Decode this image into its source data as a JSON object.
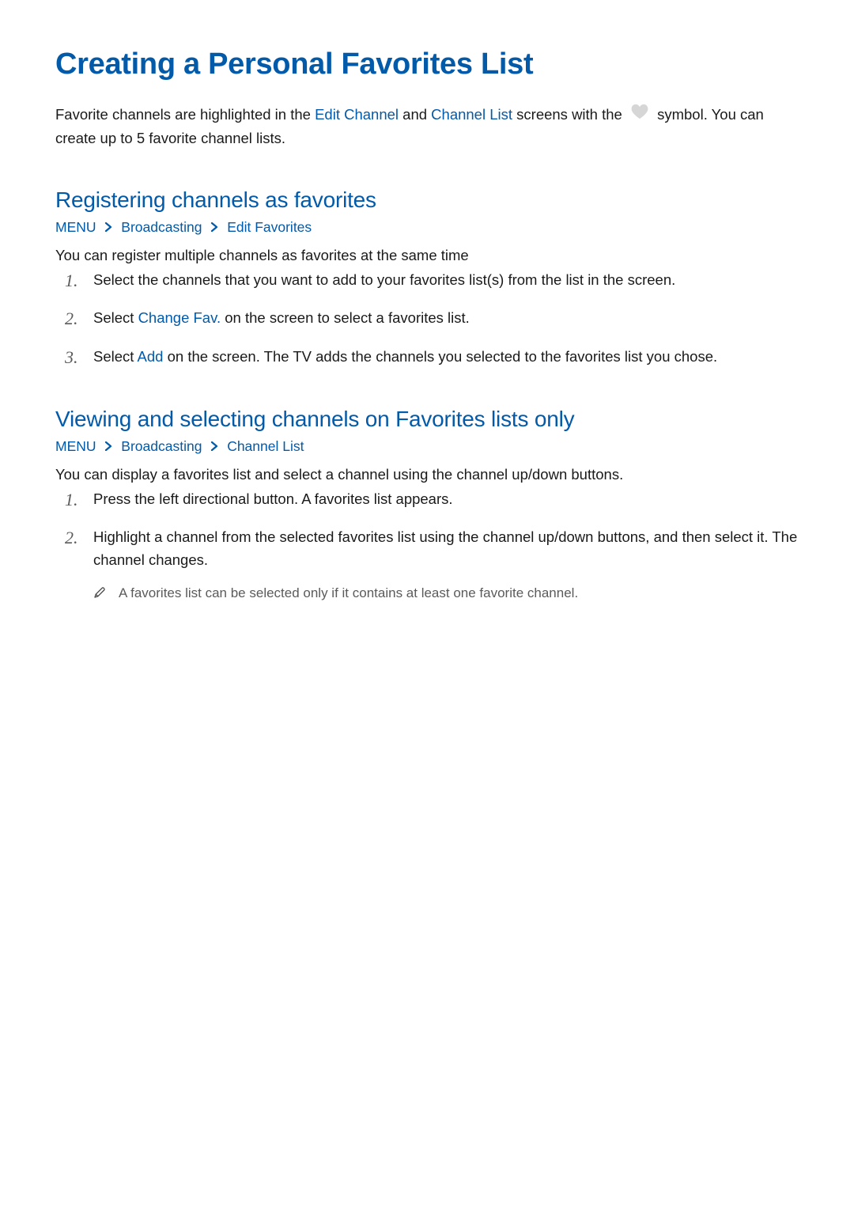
{
  "page_title": "Creating a Personal Favorites List",
  "intro": {
    "part1": "Favorite channels are highlighted in the ",
    "edit_channel": "Edit Channel",
    "and": " and ",
    "channel_list": "Channel List",
    "part2": " screens with the ",
    "part3": " symbol. You can create up to 5 favorite channel lists."
  },
  "section1": {
    "title": "Registering channels as favorites",
    "breadcrumb": {
      "menu": "MENU",
      "b1": "Broadcasting",
      "b2": "Edit Favorites"
    },
    "lead": "You can register multiple channels as favorites at the same time",
    "steps": [
      {
        "text": "Select the channels that you want to add to your favorites list(s) from the list in the screen."
      },
      {
        "prefix": "Select ",
        "accent": "Change Fav.",
        "suffix": " on the screen to select a favorites list."
      },
      {
        "prefix": "Select ",
        "accent": "Add",
        "suffix": " on the screen. The TV adds the channels you selected to the favorites list you chose."
      }
    ]
  },
  "section2": {
    "title": "Viewing and selecting channels on Favorites lists only",
    "breadcrumb": {
      "menu": "MENU",
      "b1": "Broadcasting",
      "b2": "Channel List"
    },
    "lead": "You can display a favorites list and select a channel using the channel up/down buttons.",
    "steps": [
      {
        "text": "Press the left directional button. A favorites list appears."
      },
      {
        "text": "Highlight a channel from the selected favorites list using the channel up/down buttons, and then select it. The channel changes."
      }
    ],
    "note": "A favorites list can be selected only if it contains at least one favorite channel."
  }
}
